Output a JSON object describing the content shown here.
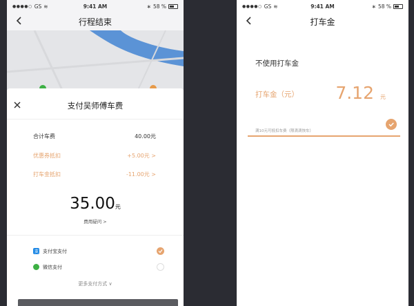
{
  "status_left": {
    "carrier": "GS",
    "time": "9:41 AM",
    "battery": "58 %"
  },
  "status_right": {
    "carrier": "GS",
    "time": "9:41 AM",
    "battery": "58 %"
  },
  "left_screen": {
    "title": "行程结束",
    "sheet_title": "支付吴师傅车费",
    "fees": [
      {
        "label": "合计车费",
        "value": "40.00元"
      },
      {
        "label": "优惠券抵扣",
        "value": "+5.00元 >"
      },
      {
        "label": "打车金抵扣",
        "value": "-11.00元 >"
      }
    ],
    "amount": "35.00",
    "amount_unit": "元",
    "fee_help": "费用疑问 >",
    "payments": [
      {
        "label": "支付宝支付",
        "selected": true
      },
      {
        "label": "微信支付",
        "selected": false
      }
    ],
    "more_pay": "更多支付方式 ∨"
  },
  "right_screen": {
    "title": "打车金",
    "option_none": "不使用打车金",
    "gold_label": "打车金（元）",
    "gold_value": "7.12",
    "gold_unit": "元",
    "gold_note": "满10元可抵扣车费（限滴滴快车）"
  },
  "colors": {
    "accent": "#e6a46f",
    "background": "#2b2c33",
    "alipay": "#1e88e5",
    "wechat": "#3db044"
  }
}
